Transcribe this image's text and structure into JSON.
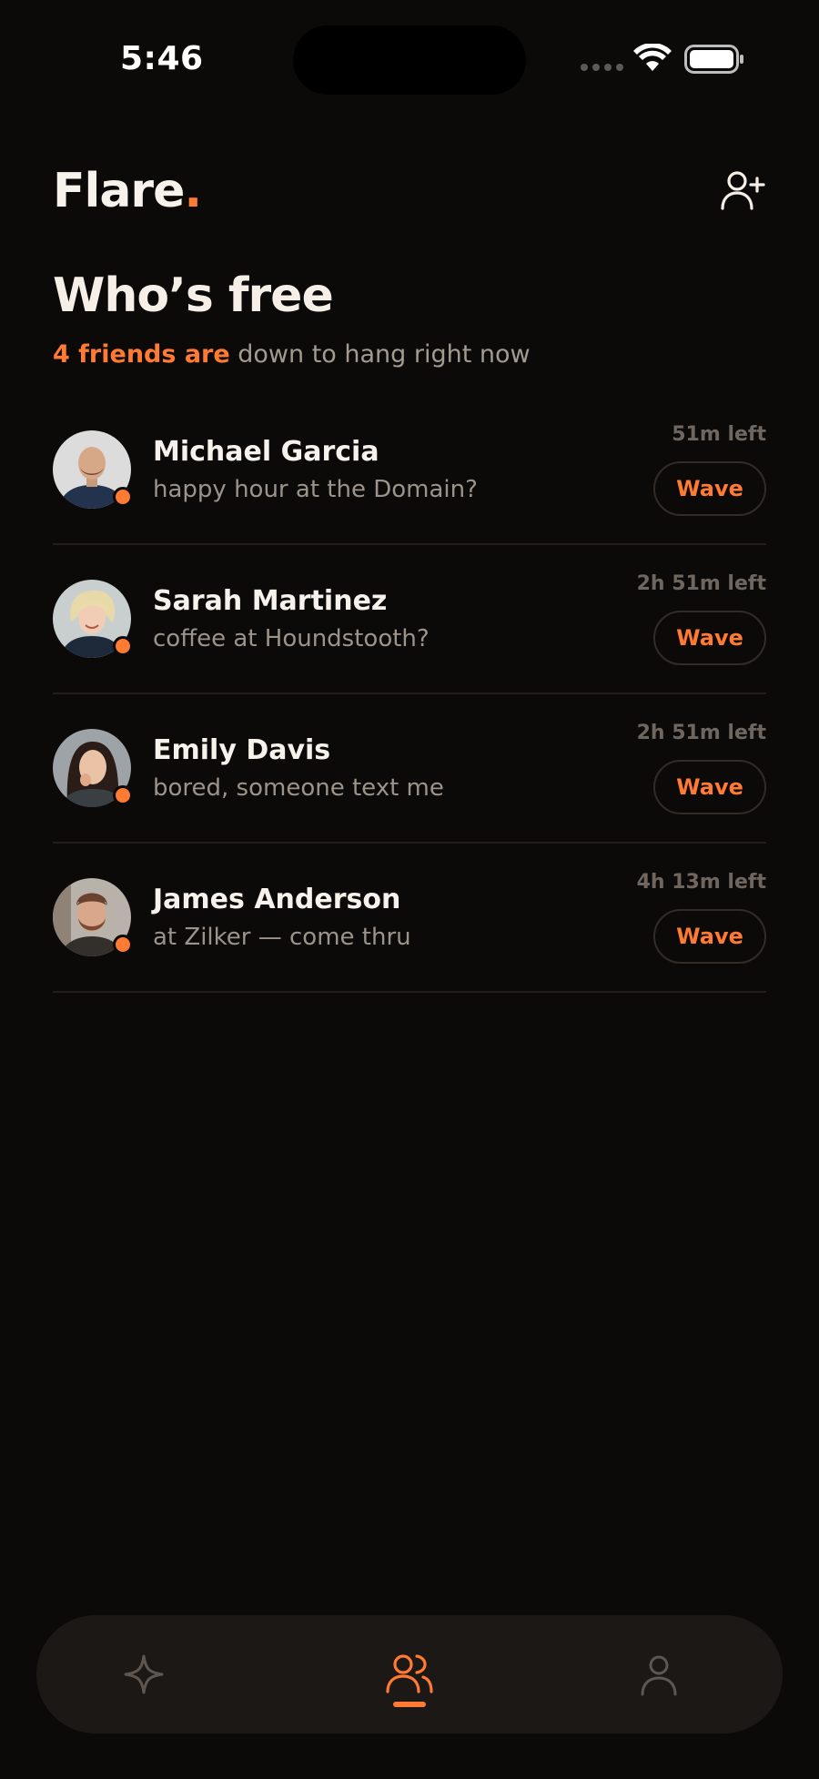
{
  "status_bar": {
    "time": "5:46"
  },
  "app": {
    "logo": "Flare",
    "logo_dot": ".",
    "accent": "#ff7a33"
  },
  "header": {
    "add_friend_icon": "user-plus-icon"
  },
  "page": {
    "title": "Who’s free",
    "subtitle_highlight": "4 friends are",
    "subtitle_rest": " down to hang right now"
  },
  "friends": [
    {
      "name": "Michael Garcia",
      "status": "happy hour at the Domain?",
      "time_left": "51m left",
      "action": "Wave"
    },
    {
      "name": "Sarah Martinez",
      "status": "coffee at Houndstooth?",
      "time_left": "2h 51m left",
      "action": "Wave"
    },
    {
      "name": "Emily Davis",
      "status": "bored, someone text me",
      "time_left": "2h 51m left",
      "action": "Wave"
    },
    {
      "name": "James Anderson",
      "status": "at Zilker — come thru",
      "time_left": "4h 13m left",
      "action": "Wave"
    }
  ],
  "tabbar": {
    "tabs": [
      {
        "icon": "sparkle-icon",
        "active": false
      },
      {
        "icon": "friends-icon",
        "active": true
      },
      {
        "icon": "profile-icon",
        "active": false
      }
    ]
  }
}
